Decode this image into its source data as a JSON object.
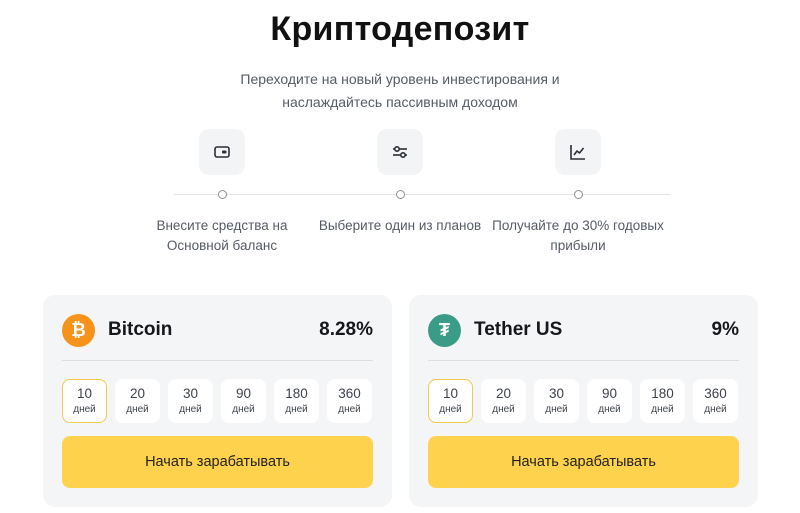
{
  "header": {
    "title": "Криптодепозит",
    "subtitle_line1": "Переходите на новый уровень инвестирования и",
    "subtitle_line2": "наслаждайтесь пассивным доходом"
  },
  "steps": [
    {
      "icon": "wallet-icon",
      "line1": "Внесите средства на",
      "line2": "Основной баланс"
    },
    {
      "icon": "sliders-icon",
      "line1": "Выберите один из планов",
      "line2": ""
    },
    {
      "icon": "chart-line-icon",
      "line1": "Получайте до 30% годовых",
      "line2": "прибыли"
    }
  ],
  "cards": [
    {
      "name": "Bitcoin",
      "rate": "8.28%",
      "icon": "bitcoin-icon",
      "icon_color": "#f7931a",
      "icon_glyph": "₿",
      "periods": [
        {
          "num": "10",
          "unit": "дней",
          "selected": true
        },
        {
          "num": "20",
          "unit": "дней",
          "selected": false
        },
        {
          "num": "30",
          "unit": "дней",
          "selected": false
        },
        {
          "num": "90",
          "unit": "дней",
          "selected": false
        },
        {
          "num": "180",
          "unit": "дней",
          "selected": false
        },
        {
          "num": "360",
          "unit": "дней",
          "selected": false
        }
      ],
      "cta": "Начать зарабатывать"
    },
    {
      "name": "Tether US",
      "rate": "9%",
      "icon": "tether-icon",
      "icon_color": "#3a9c87",
      "icon_glyph": "₮",
      "periods": [
        {
          "num": "10",
          "unit": "дней",
          "selected": true
        },
        {
          "num": "20",
          "unit": "дней",
          "selected": false
        },
        {
          "num": "30",
          "unit": "дней",
          "selected": false
        },
        {
          "num": "90",
          "unit": "дней",
          "selected": false
        },
        {
          "num": "180",
          "unit": "дней",
          "selected": false
        },
        {
          "num": "360",
          "unit": "дней",
          "selected": false
        }
      ],
      "cta": "Начать зарабатывать"
    }
  ],
  "colors": {
    "accent": "#ffd24d",
    "selected_border": "#f2c94c",
    "card_bg": "#f4f5f7"
  }
}
